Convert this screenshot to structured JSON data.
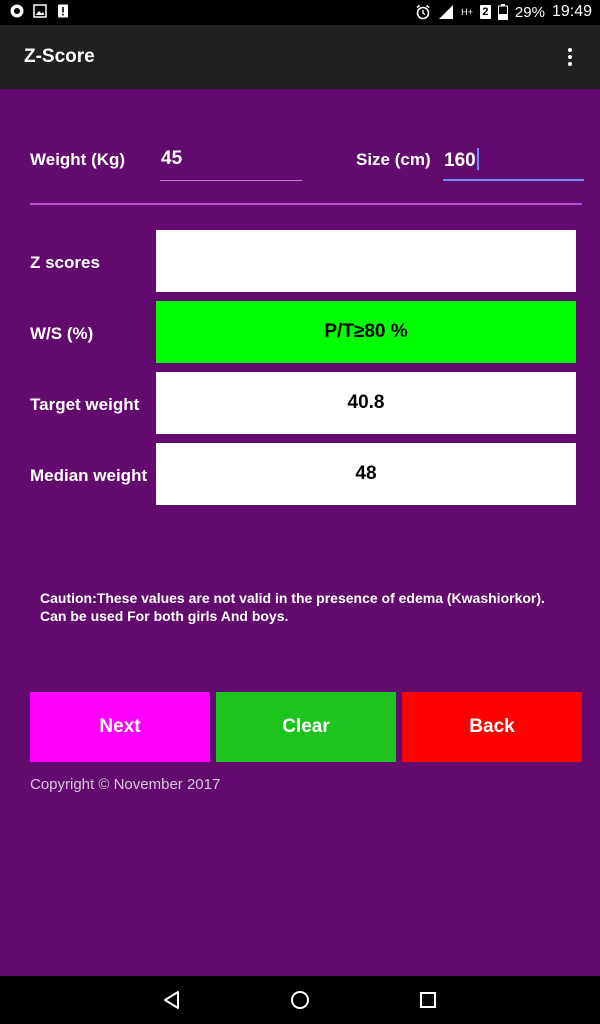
{
  "status_bar": {
    "battery_percent": "29%",
    "time": "19:49",
    "network_badge": "H+",
    "sim_badge": "2"
  },
  "app_bar": {
    "title": "Z-Score"
  },
  "inputs": {
    "weight": {
      "label": "Weight (Kg)",
      "value": "45"
    },
    "size": {
      "label": "Size (cm)",
      "value": "160"
    }
  },
  "results": [
    {
      "label": "Z scores",
      "value": ""
    },
    {
      "label": "W/S (%)",
      "value": "P/T≥80 %"
    },
    {
      "label": "Target weight",
      "value": "40.8"
    },
    {
      "label": "Median weight",
      "value": "48"
    }
  ],
  "caution": {
    "line1": "Caution:These values are not valid in the presence of edema (Kwashiorkor).",
    "line2": "Can be used For both girls And boys."
  },
  "buttons": {
    "next": "Next",
    "clear": "Clear",
    "back": "Back"
  },
  "copyright": "Copyright © November 2017",
  "colors": {
    "background": "#630a6f",
    "app_bar": "#212121",
    "divider": "#c04fd7",
    "ws_box": "#00ff00",
    "next_button": "#ff00ff",
    "clear_button": "#1ec41e",
    "back_button": "#ff0000"
  }
}
